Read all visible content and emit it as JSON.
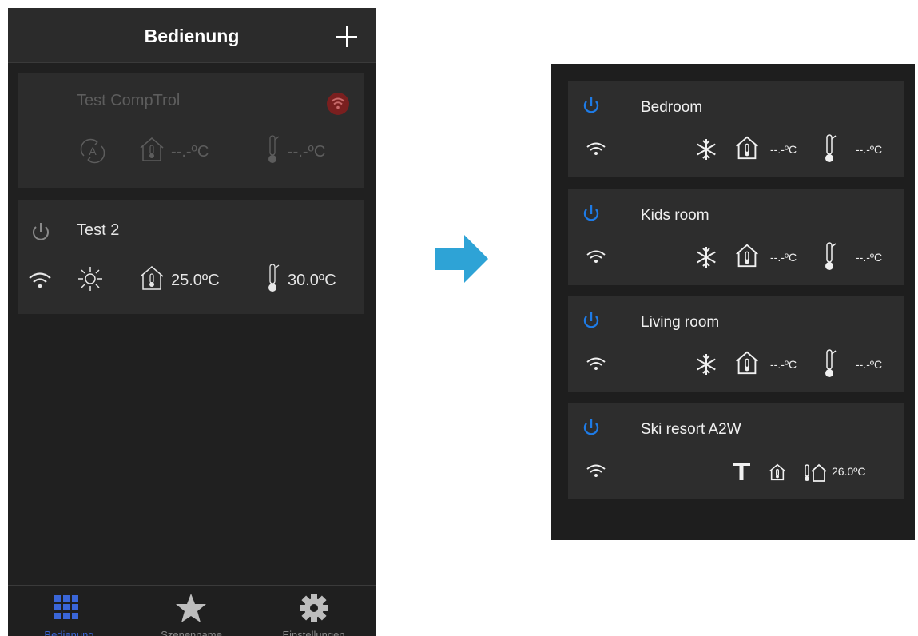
{
  "left_app": {
    "header": {
      "title": "Bedienung",
      "add_icon": "plus-icon"
    },
    "devices": [
      {
        "name": "Test CompTrol",
        "status": "disconnected",
        "mode_icon": "auto-mode-icon",
        "room_temp": "--.-ºC",
        "target_temp": "--.-ºC",
        "wifi_icon": "wifi-error-icon"
      },
      {
        "name": "Test 2",
        "status": "connected",
        "mode_icon": "sun-icon",
        "room_temp": "25.0ºC",
        "target_temp": "30.0ºC",
        "wifi_icon": "wifi-icon"
      }
    ],
    "tabs": [
      {
        "label": "Bedienung",
        "icon": "grid-icon",
        "active": true
      },
      {
        "label": "Szenenname",
        "icon": "star-icon",
        "active": false
      },
      {
        "label": "Einstellungen",
        "icon": "gear-icon",
        "active": false
      }
    ]
  },
  "arrow": {
    "icon": "arrow-right-icon",
    "color": "#2ea3d6"
  },
  "right_app": {
    "devices": [
      {
        "name": "Bedroom",
        "mode_icon": "snowflake-icon",
        "room_temp": "--.-ºC",
        "target_temp": "--.-ºC"
      },
      {
        "name": "Kids room",
        "mode_icon": "snowflake-icon",
        "room_temp": "--.-ºC",
        "target_temp": "--.-ºC"
      },
      {
        "name": "Living room",
        "mode_icon": "snowflake-icon",
        "room_temp": "--.-ºC",
        "target_temp": "--.-ºC"
      },
      {
        "name": "Ski resort A2W",
        "mode_icon": "t-icon",
        "room_temp": "26.0ºC"
      }
    ]
  },
  "colors": {
    "power_blue": "#1e7be6",
    "active_tab": "#3a66d8",
    "wifi_error": "#7a1f1f"
  }
}
